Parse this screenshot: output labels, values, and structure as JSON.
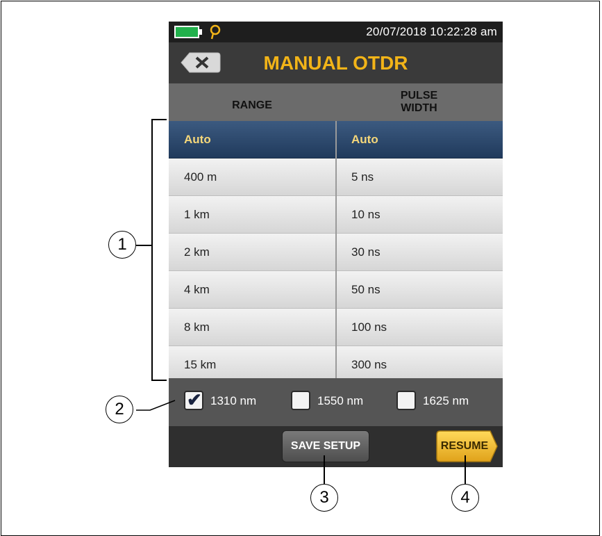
{
  "status": {
    "datetime": "20/07/2018 10:22:28 am"
  },
  "header": {
    "title": "MANUAL OTDR",
    "back_icon": "back-x-icon"
  },
  "columns": {
    "range": "RANGE",
    "pulse_line1": "PULSE",
    "pulse_line2": "WIDTH"
  },
  "rows": [
    {
      "range": "Auto",
      "pulse": "Auto",
      "selected": true
    },
    {
      "range": "400 m",
      "pulse": "5 ns"
    },
    {
      "range": "1 km",
      "pulse": "10 ns"
    },
    {
      "range": "2 km",
      "pulse": "30 ns"
    },
    {
      "range": "4 km",
      "pulse": "50 ns"
    },
    {
      "range": "8 km",
      "pulse": "100 ns"
    },
    {
      "range": "15 km",
      "pulse": "300 ns"
    }
  ],
  "wavelengths": [
    {
      "label": "1310 nm",
      "checked": true
    },
    {
      "label": "1550 nm",
      "checked": false
    },
    {
      "label": "1625 nm",
      "checked": false
    }
  ],
  "buttons": {
    "save": "SAVE SETUP",
    "resume": "RESUME"
  },
  "callouts": {
    "c1": "1",
    "c2": "2",
    "c3": "3",
    "c4": "4"
  },
  "colors": {
    "accent": "#f2b418",
    "selected_row": "#2b4a70",
    "battery": "#22b14c"
  }
}
